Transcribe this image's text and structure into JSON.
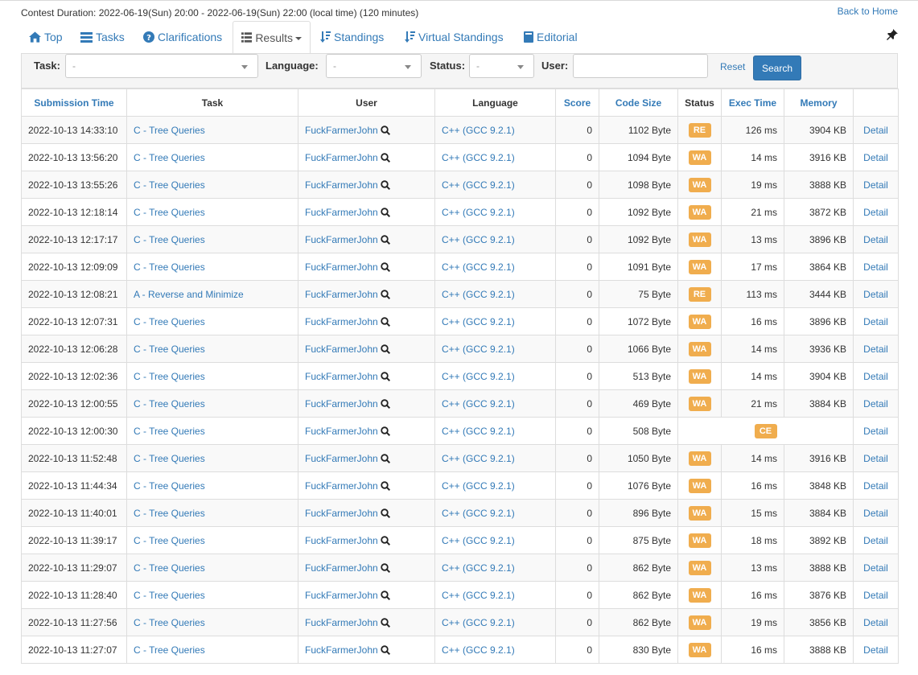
{
  "header": {
    "contest_duration": "Contest Duration: 2022-06-19(Sun) 20:00 - 2022-06-19(Sun) 22:00 (local time) (120 minutes)",
    "back_home": "Back to Home"
  },
  "tabs": [
    {
      "label": "Top",
      "icon": "home-icon"
    },
    {
      "label": "Tasks",
      "icon": "list-icon"
    },
    {
      "label": "Clarifications",
      "icon": "question-circle-icon"
    },
    {
      "label": "Results",
      "icon": "list-alt-icon",
      "active": true
    },
    {
      "label": "Standings",
      "icon": "sort-icon"
    },
    {
      "label": "Virtual Standings",
      "icon": "sort-icon"
    },
    {
      "label": "Editorial",
      "icon": "book-icon"
    }
  ],
  "filter": {
    "task_label": "Task:",
    "task_value": "-",
    "language_label": "Language:",
    "language_value": "-",
    "status_label": "Status:",
    "status_value": "-",
    "user_label": "User:",
    "user_value": "",
    "reset": "Reset",
    "search": "Search"
  },
  "table": {
    "headers": [
      "Submission Time",
      "Task",
      "User",
      "Language",
      "Score",
      "Code Size",
      "Status",
      "Exec Time",
      "Memory",
      ""
    ],
    "detail_label": "Detail",
    "rows": [
      {
        "time": "2022-10-13 14:33:10",
        "task": "C - Tree Queries",
        "user": "FuckFarmerJohn",
        "lang": "C++ (GCC 9.2.1)",
        "score": "0",
        "size": "1102 Byte",
        "status": "RE",
        "exec": "126 ms",
        "memory": "3904 KB"
      },
      {
        "time": "2022-10-13 13:56:20",
        "task": "C - Tree Queries",
        "user": "FuckFarmerJohn",
        "lang": "C++ (GCC 9.2.1)",
        "score": "0",
        "size": "1094 Byte",
        "status": "WA",
        "exec": "14 ms",
        "memory": "3916 KB"
      },
      {
        "time": "2022-10-13 13:55:26",
        "task": "C - Tree Queries",
        "user": "FuckFarmerJohn",
        "lang": "C++ (GCC 9.2.1)",
        "score": "0",
        "size": "1098 Byte",
        "status": "WA",
        "exec": "19 ms",
        "memory": "3888 KB"
      },
      {
        "time": "2022-10-13 12:18:14",
        "task": "C - Tree Queries",
        "user": "FuckFarmerJohn",
        "lang": "C++ (GCC 9.2.1)",
        "score": "0",
        "size": "1092 Byte",
        "status": "WA",
        "exec": "21 ms",
        "memory": "3872 KB"
      },
      {
        "time": "2022-10-13 12:17:17",
        "task": "C - Tree Queries",
        "user": "FuckFarmerJohn",
        "lang": "C++ (GCC 9.2.1)",
        "score": "0",
        "size": "1092 Byte",
        "status": "WA",
        "exec": "13 ms",
        "memory": "3896 KB"
      },
      {
        "time": "2022-10-13 12:09:09",
        "task": "C - Tree Queries",
        "user": "FuckFarmerJohn",
        "lang": "C++ (GCC 9.2.1)",
        "score": "0",
        "size": "1091 Byte",
        "status": "WA",
        "exec": "17 ms",
        "memory": "3864 KB"
      },
      {
        "time": "2022-10-13 12:08:21",
        "task": "A - Reverse and Minimize",
        "user": "FuckFarmerJohn",
        "lang": "C++ (GCC 9.2.1)",
        "score": "0",
        "size": "75 Byte",
        "status": "RE",
        "exec": "113 ms",
        "memory": "3444 KB"
      },
      {
        "time": "2022-10-13 12:07:31",
        "task": "C - Tree Queries",
        "user": "FuckFarmerJohn",
        "lang": "C++ (GCC 9.2.1)",
        "score": "0",
        "size": "1072 Byte",
        "status": "WA",
        "exec": "16 ms",
        "memory": "3896 KB"
      },
      {
        "time": "2022-10-13 12:06:28",
        "task": "C - Tree Queries",
        "user": "FuckFarmerJohn",
        "lang": "C++ (GCC 9.2.1)",
        "score": "0",
        "size": "1066 Byte",
        "status": "WA",
        "exec": "14 ms",
        "memory": "3936 KB"
      },
      {
        "time": "2022-10-13 12:02:36",
        "task": "C - Tree Queries",
        "user": "FuckFarmerJohn",
        "lang": "C++ (GCC 9.2.1)",
        "score": "0",
        "size": "513 Byte",
        "status": "WA",
        "exec": "14 ms",
        "memory": "3904 KB"
      },
      {
        "time": "2022-10-13 12:00:55",
        "task": "C - Tree Queries",
        "user": "FuckFarmerJohn",
        "lang": "C++ (GCC 9.2.1)",
        "score": "0",
        "size": "469 Byte",
        "status": "WA",
        "exec": "21 ms",
        "memory": "3884 KB"
      },
      {
        "time": "2022-10-13 12:00:30",
        "task": "C - Tree Queries",
        "user": "FuckFarmerJohn",
        "lang": "C++ (GCC 9.2.1)",
        "score": "0",
        "size": "508 Byte",
        "status": "CE",
        "exec": "",
        "memory": ""
      },
      {
        "time": "2022-10-13 11:52:48",
        "task": "C - Tree Queries",
        "user": "FuckFarmerJohn",
        "lang": "C++ (GCC 9.2.1)",
        "score": "0",
        "size": "1050 Byte",
        "status": "WA",
        "exec": "14 ms",
        "memory": "3916 KB"
      },
      {
        "time": "2022-10-13 11:44:34",
        "task": "C - Tree Queries",
        "user": "FuckFarmerJohn",
        "lang": "C++ (GCC 9.2.1)",
        "score": "0",
        "size": "1076 Byte",
        "status": "WA",
        "exec": "16 ms",
        "memory": "3848 KB"
      },
      {
        "time": "2022-10-13 11:40:01",
        "task": "C - Tree Queries",
        "user": "FuckFarmerJohn",
        "lang": "C++ (GCC 9.2.1)",
        "score": "0",
        "size": "896 Byte",
        "status": "WA",
        "exec": "15 ms",
        "memory": "3884 KB"
      },
      {
        "time": "2022-10-13 11:39:17",
        "task": "C - Tree Queries",
        "user": "FuckFarmerJohn",
        "lang": "C++ (GCC 9.2.1)",
        "score": "0",
        "size": "875 Byte",
        "status": "WA",
        "exec": "18 ms",
        "memory": "3892 KB"
      },
      {
        "time": "2022-10-13 11:29:07",
        "task": "C - Tree Queries",
        "user": "FuckFarmerJohn",
        "lang": "C++ (GCC 9.2.1)",
        "score": "0",
        "size": "862 Byte",
        "status": "WA",
        "exec": "13 ms",
        "memory": "3888 KB"
      },
      {
        "time": "2022-10-13 11:28:40",
        "task": "C - Tree Queries",
        "user": "FuckFarmerJohn",
        "lang": "C++ (GCC 9.2.1)",
        "score": "0",
        "size": "862 Byte",
        "status": "WA",
        "exec": "16 ms",
        "memory": "3876 KB"
      },
      {
        "time": "2022-10-13 11:27:56",
        "task": "C - Tree Queries",
        "user": "FuckFarmerJohn",
        "lang": "C++ (GCC 9.2.1)",
        "score": "0",
        "size": "862 Byte",
        "status": "WA",
        "exec": "19 ms",
        "memory": "3856 KB"
      },
      {
        "time": "2022-10-13 11:27:07",
        "task": "C - Tree Queries",
        "user": "FuckFarmerJohn",
        "lang": "C++ (GCC 9.2.1)",
        "score": "0",
        "size": "830 Byte",
        "status": "WA",
        "exec": "16 ms",
        "memory": "3888 KB"
      }
    ]
  },
  "colors": {
    "link": "#337ab7",
    "badge_warning": "#f0ad4e",
    "primary_button": "#337ab7"
  }
}
